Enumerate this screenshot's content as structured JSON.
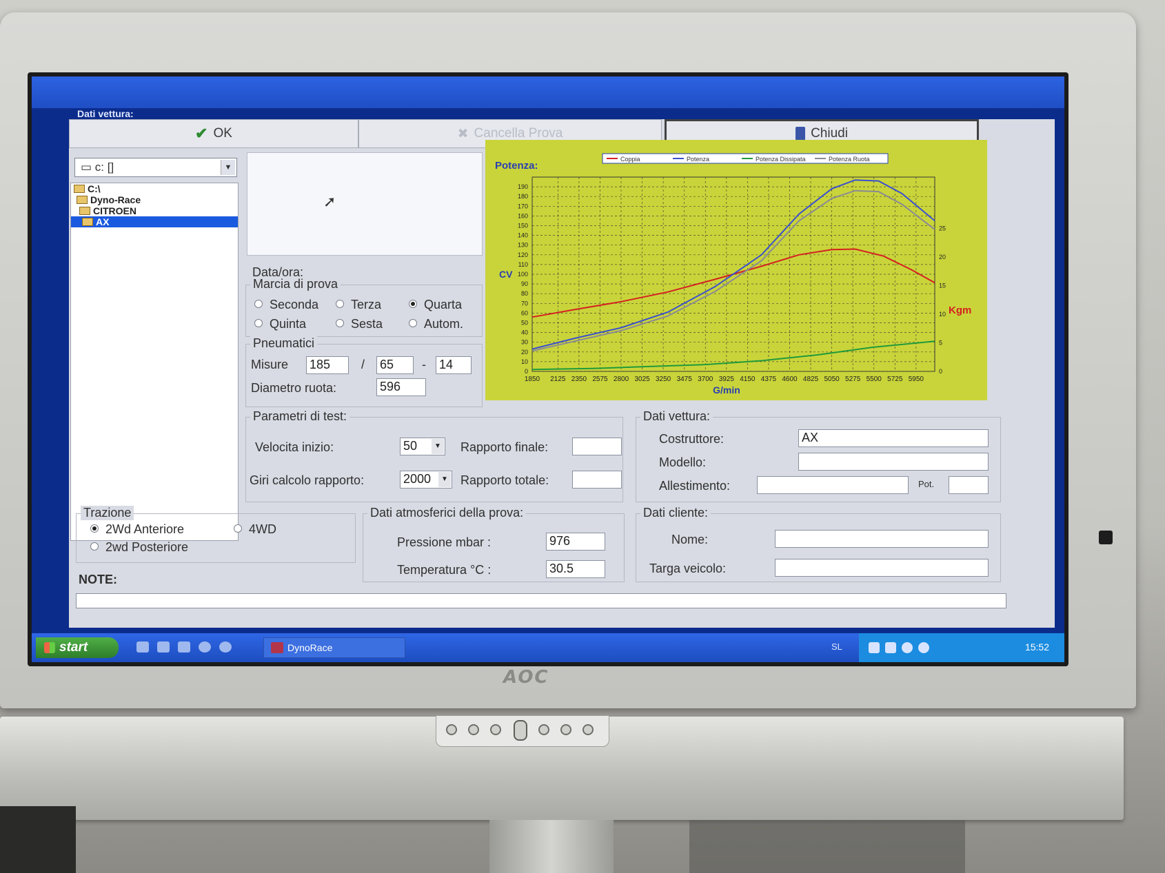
{
  "window": {
    "title": "Dati vettura:"
  },
  "toolbar": {
    "ok_label": "OK",
    "cancel_label": "Cancella Prova",
    "close_label": "Chiudi"
  },
  "drive": {
    "selected": "c: []",
    "tree": [
      "C:\\",
      "Dyno-Race",
      "CITROEN",
      "AX"
    ]
  },
  "form": {
    "datetime_label": "Data/ora:",
    "gear": {
      "title": "Marcia di prova",
      "options": [
        "Seconda",
        "Terza",
        "Quarta",
        "Quinta",
        "Sesta",
        "Autom."
      ],
      "selected": "Quarta"
    },
    "tires": {
      "title": "Pneumatici",
      "size_label": "Misure",
      "width": "185",
      "slash": "/",
      "ratio": "65",
      "dash": "-",
      "rim": "14",
      "diameter_label": "Diametro ruota:",
      "diameter": "596"
    },
    "test_params": {
      "title": "Parametri di test:",
      "start_speed_label": "Velocita inizio:",
      "start_speed": "50",
      "rpm_label": "Giri calcolo rapporto:",
      "rpm": "2000",
      "final_ratio_label": "Rapporto finale:",
      "final_ratio": "",
      "total_ratio_label": "Rapporto totale:",
      "total_ratio": ""
    },
    "car": {
      "title": "Dati vettura:",
      "maker_label": "Costruttore:",
      "maker": "AX",
      "model_label": "Modello:",
      "model": "",
      "trim_label": "Allestimento:",
      "trim": "",
      "power_label": "Pot.",
      "power": ""
    },
    "traction": {
      "title": "Trazione",
      "options": [
        "2Wd Anteriore",
        "4WD",
        "2wd Posteriore"
      ],
      "selected": "2Wd Anteriore"
    },
    "atmo": {
      "title": "Dati atmosferici della prova:",
      "pressure_label": "Pressione  mbar  :",
      "pressure": "976",
      "temp_label": "Temperatura °C   :",
      "temp": "30.5"
    },
    "customer": {
      "title": "Dati cliente:",
      "name_label": "Nome:",
      "name": "",
      "plate_label": "Targa veicolo:",
      "plate": ""
    },
    "notes_label": "NOTE:"
  },
  "chart_data": {
    "type": "line",
    "title": "Potenza:",
    "xlabel": "G/min",
    "ylabel": "CV",
    "y2label": "Kgm",
    "x_ticks": [
      1850,
      2125,
      2350,
      2575,
      2800,
      3025,
      3250,
      3475,
      3700,
      3925,
      4150,
      4375,
      4600,
      4825,
      5050,
      5275,
      5500,
      5725,
      5950
    ],
    "xlim": [
      1850,
      6150
    ],
    "ylim": [
      0,
      200
    ],
    "y_ticks": [
      0,
      10,
      20,
      30,
      40,
      50,
      60,
      70,
      80,
      90,
      100,
      110,
      120,
      130,
      140,
      150,
      160,
      170,
      180,
      190
    ],
    "y2lim": [
      0,
      34
    ],
    "y2_ticks": [
      0,
      5,
      10,
      15,
      20,
      25
    ],
    "grid": true,
    "legend_position": "top",
    "series": [
      {
        "name": "Coppia",
        "axis": "right",
        "color": "#d42020",
        "x": [
          1850,
          2300,
          2800,
          3300,
          3800,
          4300,
          4700,
          5050,
          5300,
          5600,
          5900,
          6150
        ],
        "y": [
          9.5,
          10.8,
          12.2,
          13.9,
          16.1,
          18.4,
          20.4,
          21.3,
          21.4,
          20.2,
          17.8,
          15.5
        ]
      },
      {
        "name": "Potenza",
        "axis": "left",
        "color": "#3a4fd0",
        "x": [
          1850,
          2300,
          2800,
          3300,
          3800,
          4300,
          4700,
          5050,
          5300,
          5550,
          5800,
          6150
        ],
        "y": [
          23,
          34,
          45,
          61,
          87,
          120,
          162,
          188,
          197,
          196,
          183,
          155
        ]
      },
      {
        "name": "Potenza Dissipata",
        "axis": "left",
        "color": "#1f9a3a",
        "x": [
          1850,
          2500,
          3100,
          3700,
          4300,
          4900,
          5500,
          6150
        ],
        "y": [
          2,
          3,
          5,
          7,
          11,
          17,
          25,
          31
        ]
      },
      {
        "name": "Potenza Ruota",
        "axis": "left",
        "color": "#8a8a94",
        "x": [
          1850,
          2300,
          2800,
          3300,
          3800,
          4300,
          4700,
          5050,
          5300,
          5550,
          5800,
          6150
        ],
        "y": [
          21,
          31,
          42,
          57,
          82,
          114,
          155,
          178,
          186,
          185,
          172,
          146
        ]
      }
    ]
  },
  "taskbar": {
    "start_label": "start",
    "task_label": "DynoRace",
    "lang": "SL",
    "clock": "15:52"
  },
  "monitor": {
    "brand": "AOC"
  },
  "colors": {
    "chart_bg": "#c9d43a",
    "title_blue": "#1f4ec5",
    "accent_red": "#d42020"
  }
}
